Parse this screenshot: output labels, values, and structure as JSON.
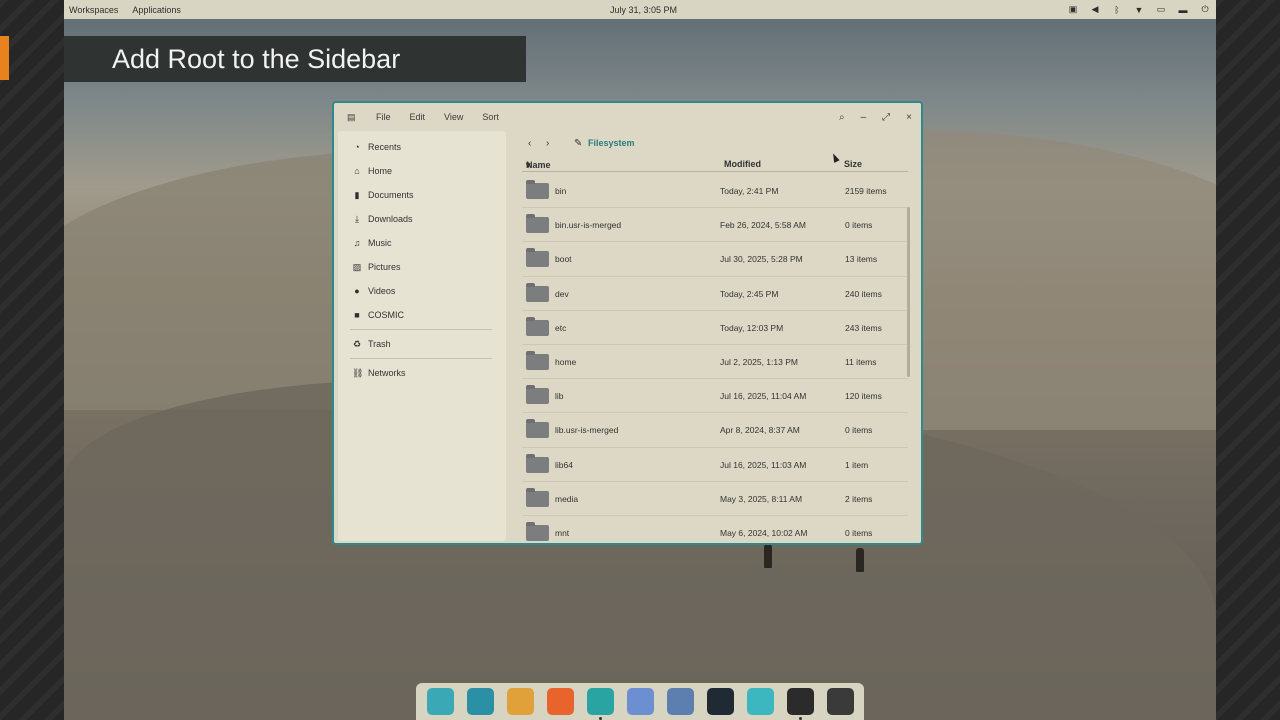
{
  "top_panel": {
    "workspaces": "Workspaces",
    "applications": "Applications",
    "clock": "July 31, 3:05 PM",
    "tray_icons": [
      "display-icon",
      "volume-icon",
      "bluetooth-icon",
      "wifi-icon",
      "battery-icon",
      "notifications-icon",
      "power-icon"
    ]
  },
  "banner": {
    "title": "Add Root to the Sidebar"
  },
  "window": {
    "menu": [
      "File",
      "Edit",
      "View",
      "Sort"
    ],
    "controls": [
      "search-icon",
      "minimize-icon",
      "maximize-icon",
      "close-icon"
    ],
    "sidebar": {
      "items": [
        {
          "label": "Recents",
          "icon": "recents-icon"
        },
        {
          "label": "Home",
          "icon": "home-icon"
        },
        {
          "label": "Documents",
          "icon": "documents-icon"
        },
        {
          "label": "Downloads",
          "icon": "downloads-icon"
        },
        {
          "label": "Music",
          "icon": "music-icon"
        },
        {
          "label": "Pictures",
          "icon": "pictures-icon"
        },
        {
          "label": "Videos",
          "icon": "videos-icon"
        },
        {
          "label": "COSMIC",
          "icon": "folder-icon"
        },
        {
          "label": "Trash",
          "icon": "trash-icon"
        },
        {
          "label": "Networks",
          "icon": "networks-icon"
        }
      ]
    },
    "breadcrumb": "Filesystem",
    "columns": {
      "name": "Name",
      "modified": "Modified",
      "size": "Size"
    },
    "rows": [
      {
        "name": "bin",
        "modified": "Today, 2:41 PM",
        "size": "2159 items"
      },
      {
        "name": "bin.usr-is-merged",
        "modified": "Feb 26, 2024, 5:58 AM",
        "size": "0 items"
      },
      {
        "name": "boot",
        "modified": "Jul 30, 2025, 5:28 PM",
        "size": "13 items"
      },
      {
        "name": "dev",
        "modified": "Today, 2:45 PM",
        "size": "240 items"
      },
      {
        "name": "etc",
        "modified": "Today, 12:03 PM",
        "size": "243 items"
      },
      {
        "name": "home",
        "modified": "Jul 2, 2025, 1:13 PM",
        "size": "11 items"
      },
      {
        "name": "lib",
        "modified": "Jul 16, 2025, 11:04 AM",
        "size": "120 items"
      },
      {
        "name": "lib.usr-is-merged",
        "modified": "Apr 8, 2024, 8:37 AM",
        "size": "0 items"
      },
      {
        "name": "lib64",
        "modified": "Jul 16, 2025, 11:03 AM",
        "size": "1 item"
      },
      {
        "name": "media",
        "modified": "May 3, 2025, 8:11 AM",
        "size": "2 items"
      },
      {
        "name": "mnt",
        "modified": "May 6, 2024, 10:02 AM",
        "size": "0 items"
      }
    ]
  },
  "dock": {
    "apps": [
      {
        "name": "screenshot-app-icon",
        "color": "#3aa9b5"
      },
      {
        "name": "workspaces-app-icon",
        "color": "#2b8fa6"
      },
      {
        "name": "app-library-icon",
        "color": "#e0a13a"
      },
      {
        "name": "firefox-icon",
        "color": "#e8642c"
      },
      {
        "name": "files-app-icon",
        "color": "#2aa3a3"
      },
      {
        "name": "store-app-icon",
        "color": "#6b8fd1"
      },
      {
        "name": "text-editor-icon",
        "color": "#5c7fb0"
      },
      {
        "name": "terminal-icon",
        "color": "#1f2a33"
      },
      {
        "name": "settings-app-icon",
        "color": "#3cb6bf"
      },
      {
        "name": "obs-icon",
        "color": "#2b2b2b"
      },
      {
        "name": "screen-record-icon",
        "color": "#3a3a3a"
      }
    ]
  }
}
